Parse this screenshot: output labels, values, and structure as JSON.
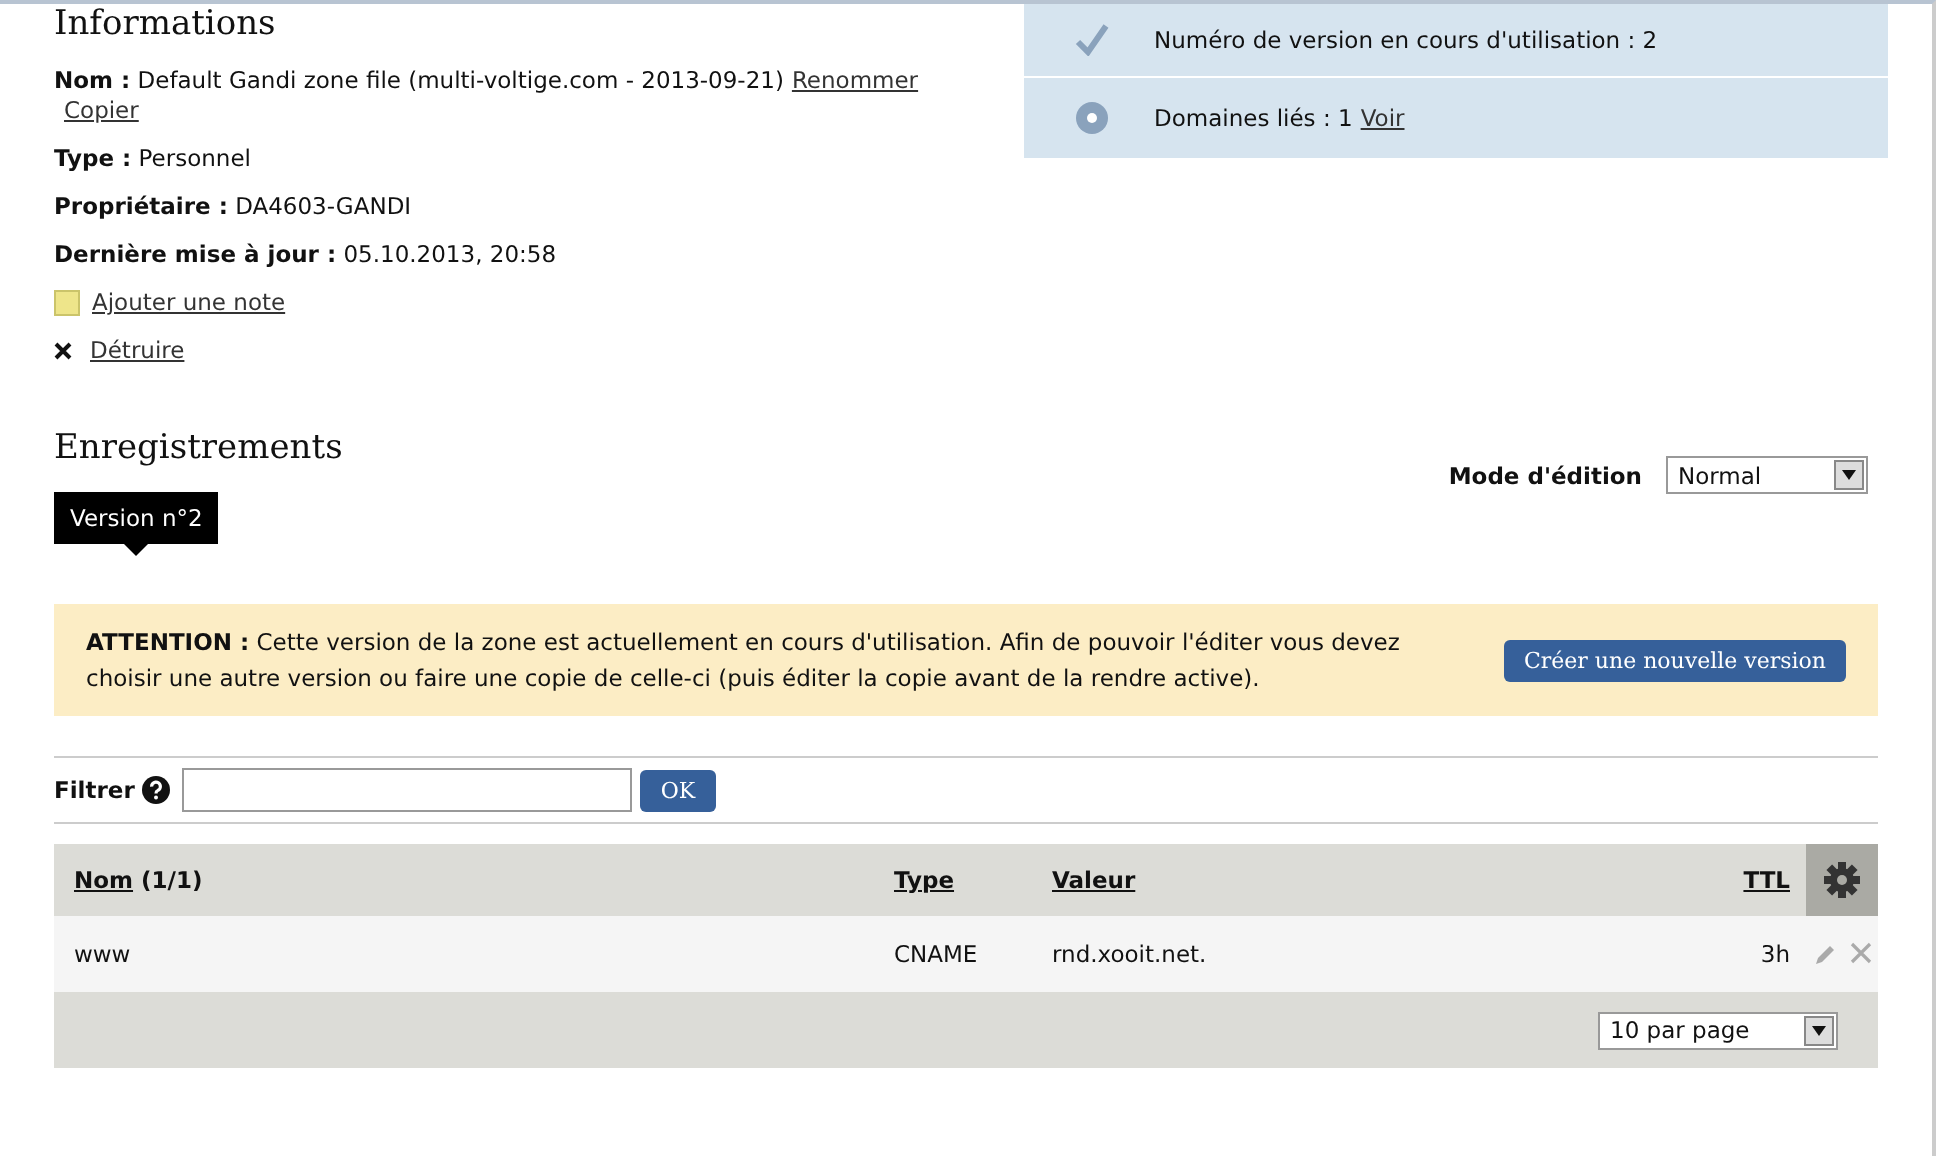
{
  "info": {
    "title": "Informations",
    "fields": [
      {
        "label": "Nom :",
        "value": "Default Gandi zone file (multi-voltige.com - 2013-09-21)",
        "links": [
          "Renommer",
          "Copier"
        ]
      },
      {
        "label": "Type :",
        "value": "Personnel"
      },
      {
        "label": "Propriétaire :",
        "value": "DA4603-GANDI"
      },
      {
        "label": "Dernière mise à jour :",
        "value": "05.10.2013, 20:58"
      }
    ],
    "actions": [
      {
        "kind": "note",
        "label": "Ajouter une note"
      },
      {
        "kind": "delete",
        "label": "Détruire"
      }
    ]
  },
  "status": [
    {
      "kind": "check",
      "text": "Numéro de version en cours d'utilisation : 2"
    },
    {
      "kind": "disc",
      "text": "Domaines liés : 1",
      "link": "Voir"
    }
  ],
  "records": {
    "title": "Enregistrements",
    "version_tag": "Version n°2",
    "mode_label": "Mode d'édition",
    "mode_value": "Normal",
    "warning": {
      "text": "**ATTENTION :** Cette version de la zone est actuellement en cours d'utilisation. Afin de pouvoir l'éditer vous devez choisir une autre version ou faire une copie de celle-ci (puis éditer la copie avant de la rendre active).",
      "button": "Créer une nouvelle version"
    },
    "filter": {
      "label": "Filtrer",
      "button": "OK"
    },
    "table": {
      "columns": [
        {
          "label": "Nom",
          "extra": "(1/1)"
        },
        {
          "label": "Type"
        },
        {
          "label": "Valeur"
        },
        {
          "label": "TTL"
        }
      ],
      "rows": [
        {
          "cells": [
            "www",
            "CNAME",
            "rnd.xooit.net.",
            "3h"
          ]
        }
      ]
    },
    "per_page": "10 par page"
  }
}
